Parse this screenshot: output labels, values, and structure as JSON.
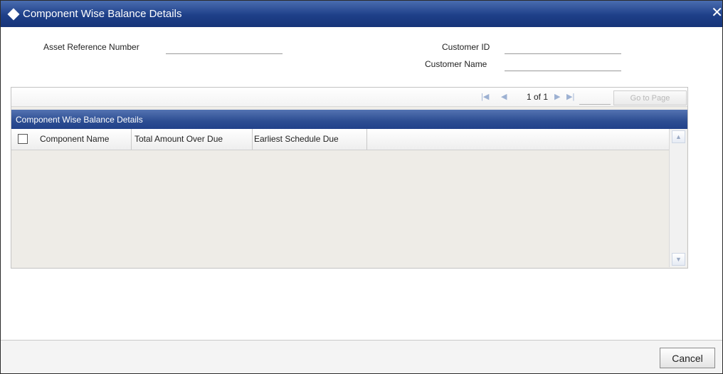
{
  "window": {
    "title": "Component Wise Balance Details",
    "close_glyph": "✕"
  },
  "form": {
    "asset_reference_label": "Asset Reference Number",
    "asset_reference_value": "",
    "customer_id_label": "Customer ID",
    "customer_id_value": "",
    "customer_name_label": "Customer Name",
    "customer_name_value": ""
  },
  "pager": {
    "first_icon": "first-page-icon",
    "prev_icon": "previous-page-icon",
    "next_icon": "next-page-icon",
    "last_icon": "last-page-icon",
    "page_text": "1 of 1",
    "page_input_value": "",
    "goto_label": "Go to Page"
  },
  "grid": {
    "section_title": "Component Wise Balance Details",
    "columns": [
      "Component Name",
      "Total Amount Over Due",
      "Earliest Schedule Due"
    ],
    "rows": []
  },
  "footer": {
    "cancel_label": "Cancel"
  },
  "colors": {
    "title_bar": "#1e3f88",
    "section_header": "#2c4d92",
    "grid_background": "#eeece7"
  }
}
